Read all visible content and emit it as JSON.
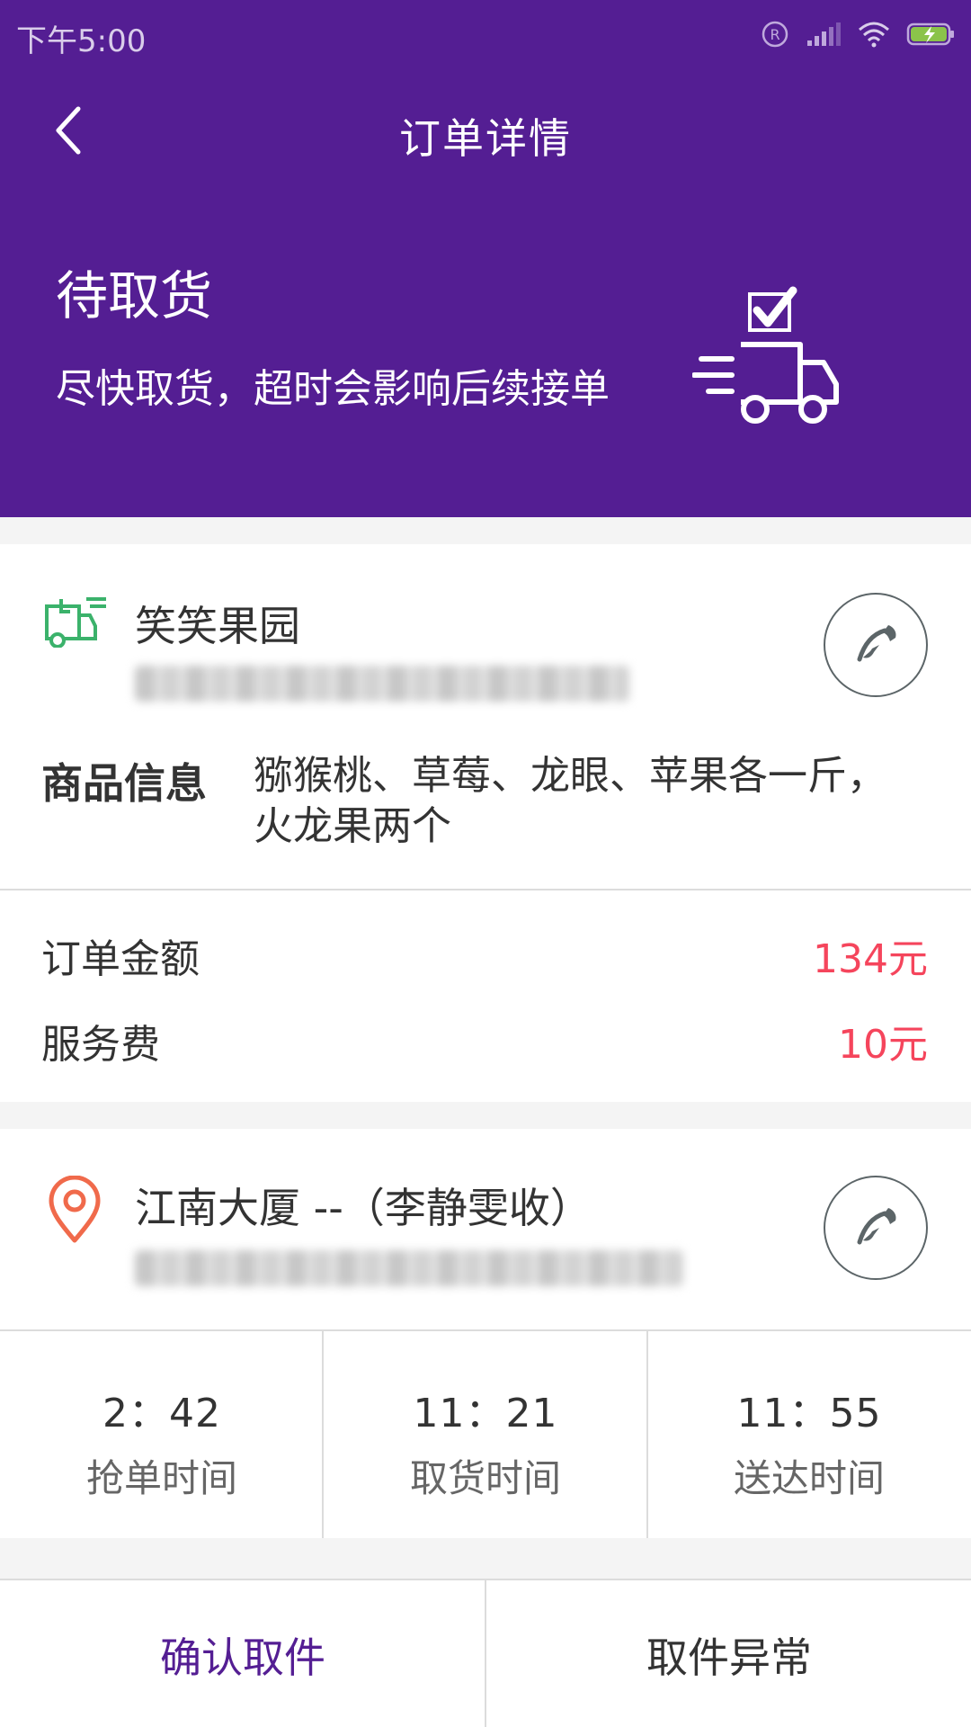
{
  "status_bar": {
    "time": "下午5:00"
  },
  "nav": {
    "title": "订单详情"
  },
  "order_status": {
    "heading": "待取货",
    "description": "尽快取货，超时会影响后续接单"
  },
  "shop": {
    "name": "笑笑果园",
    "goods_label": "商品信息",
    "goods_value": "猕猴桃、草莓、龙眼、苹果各一斤，火龙果两个"
  },
  "fees": {
    "order_amount_label": "订单金额",
    "order_amount_value": "134元",
    "service_fee_label": "服务费",
    "service_fee_value": "10元"
  },
  "recipient": {
    "name": "江南大厦 --（李静雯收）"
  },
  "times": [
    {
      "value": "2：42",
      "label": "抢单时间"
    },
    {
      "value": "11：21",
      "label": "取货时间"
    },
    {
      "value": "11：55",
      "label": "送达时间"
    }
  ],
  "actions": {
    "confirm_label": "确认取件",
    "exception_label": "取件异常"
  },
  "colors": {
    "brand_purple": "#541e93",
    "price_red": "#f5455c",
    "shop_icon_green": "#3bb26b",
    "location_icon_orange": "#f06a4b"
  }
}
